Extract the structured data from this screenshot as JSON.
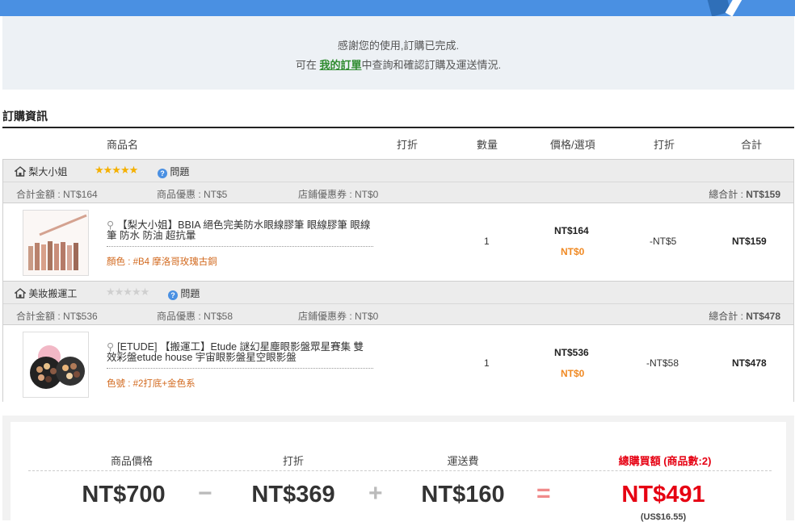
{
  "notice": {
    "line1": "感謝您的使用,訂購已完成.",
    "line2_prefix": "可在 ",
    "line2_link": "我的訂單",
    "line2_suffix": "中查詢和確認訂購及運送情況."
  },
  "section_title": "訂購資訊",
  "columns": {
    "product": "商品名",
    "discount1": "打折",
    "qty": "數量",
    "price": "價格/選項",
    "discount2": "打折",
    "total": "合計"
  },
  "shops": [
    {
      "name": "梨大小姐",
      "rating_stars": 5,
      "rating_color": "#f5b000",
      "question_label": "問題",
      "sum_label": "合計金額 : NT$164",
      "product_discount": "商品優惠 : NT$5",
      "coupon": "店鋪優惠券 : NT$0",
      "grand_label": "總合計 : ",
      "grand_value": "NT$159",
      "item": {
        "name": "【梨大小姐】BBIA 絕色完美防水眼線膠筆 眼線膠筆 眼線筆 防水 防油 超抗暈",
        "option": "顏色 : #B4 摩洛哥玫瑰古銅",
        "qty": "1",
        "price": "NT$164",
        "option_price": "NT$0",
        "discount": "-NT$5",
        "total": "NT$159"
      }
    },
    {
      "name": "美妝搬運工",
      "rating_stars": 0,
      "rating_color": "#cfcfcf",
      "question_label": "問題",
      "sum_label": "合計金額 : NT$536",
      "product_discount": "商品優惠 : NT$58",
      "coupon": "店鋪優惠券 : NT$0",
      "grand_label": "總合計 : ",
      "grand_value": "NT$478",
      "item": {
        "name": "[ETUDE] 【搬運工】Etude 謎幻星塵眼影盤眾星賽集 雙效彩盤etude house 宇宙眼影盤星空眼影盤",
        "option": "色號 : #2打底+金色系",
        "qty": "1",
        "price": "NT$536",
        "option_price": "NT$0",
        "discount": "-NT$58",
        "total": "NT$478"
      }
    }
  ],
  "summary": {
    "product_price_label": "商品價格",
    "discount_label": "打折",
    "shipping_label": "運送費",
    "total_label": "總購買額 (商品數:2)",
    "product_price": "NT$700",
    "discount": "NT$369",
    "shipping": "NT$160",
    "total": "NT$491",
    "total_usd": "(US$16.55)",
    "op_minus": "−",
    "op_plus": "+",
    "op_equals": "=",
    "accent_color": "#e60012"
  }
}
